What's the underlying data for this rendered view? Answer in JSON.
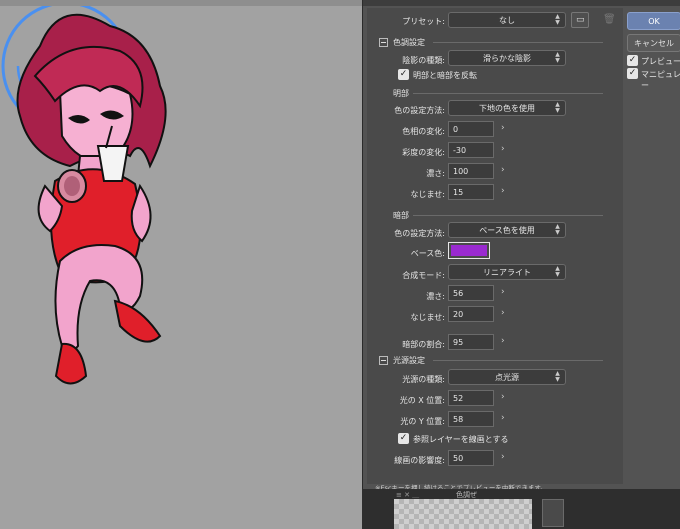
{
  "dialog": {
    "preset_label": "プリセット:",
    "preset_value": "なし",
    "tone_section": "色調設定",
    "shadow_type_label": "陰影の種類:",
    "shadow_type_value": "滑らかな陰影",
    "invert_label": "明部と暗部を反転",
    "invert_checked": true,
    "light_section": "明部",
    "light_method_label": "色の設定方法:",
    "light_method_value": "下地の色を使用",
    "hue_label": "色相の変化:",
    "hue_value": "0",
    "sat_label": "彩度の変化:",
    "sat_value": "-30",
    "lum_label": "濃さ:",
    "lum_value": "100",
    "smooth_label": "なじませ:",
    "smooth_value": "15",
    "dark_section": "暗部",
    "dark_method_label": "色の設定方法:",
    "dark_method_value": "ベース色を使用",
    "base_color_label": "ベース色:",
    "base_color": "#9a2ad0",
    "blend_label": "合成モード:",
    "blend_value": "リニアライト",
    "dark_lum_label": "濃さ:",
    "dark_lum_value": "56",
    "dark_smooth_label": "なじませ:",
    "dark_smooth_value": "20",
    "dark_ratio_label": "暗部の割合:",
    "dark_ratio_value": "95",
    "light_source_section": "光源設定",
    "source_type_label": "光源の種類:",
    "source_type_value": "点光源",
    "x_label": "光の X 位置:",
    "x_value": "52",
    "y_label": "光の Y 位置:",
    "y_value": "58",
    "ref_layer_label": "参照レイヤーを線画とする",
    "ref_layer_checked": true,
    "line_influence_label": "線画の影響度:",
    "line_influence_value": "50",
    "hint": "※Escキーを押し続けることでプレビューを中断できます。"
  },
  "buttons": {
    "ok": "OK",
    "cancel": "キャンセル",
    "preview": "プレビュー",
    "manipulator": "マニピュレー"
  },
  "layer_panel": {
    "title": "色調ぜ"
  },
  "colors": {
    "accent_blue": "#4a90f0",
    "ok_button": "#6b82b0",
    "hair": "#b02a4a",
    "dress": "#e01f2a",
    "skin": "#f2a4cc"
  }
}
